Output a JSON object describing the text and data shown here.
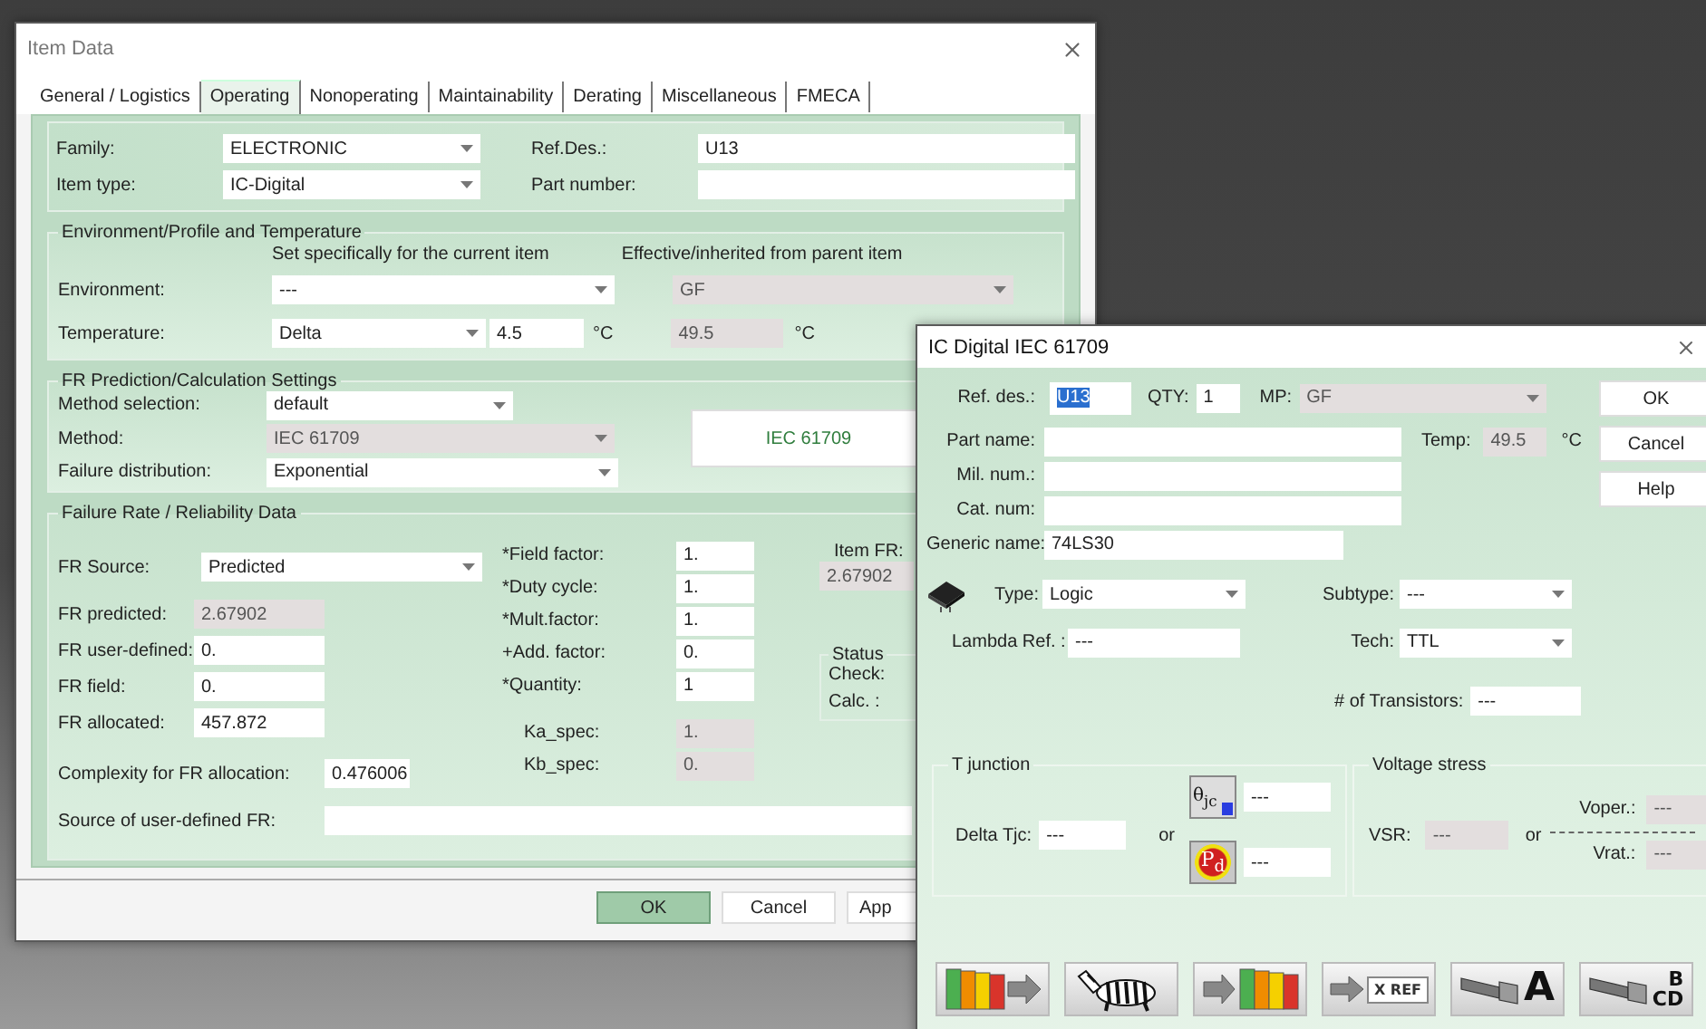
{
  "item_window": {
    "title": "Item Data",
    "tabs": [
      {
        "label": "General / Logistics",
        "selected": false
      },
      {
        "label": "Operating",
        "selected": true
      },
      {
        "label": "Nonoperating",
        "selected": false
      },
      {
        "label": "Maintainability",
        "selected": false
      },
      {
        "label": "Derating",
        "selected": false
      },
      {
        "label": "Miscellaneous",
        "selected": false
      },
      {
        "label": "FMECA",
        "selected": false
      }
    ],
    "family": {
      "label": "Family:",
      "value": "ELECTRONIC"
    },
    "item_type": {
      "label": "Item type:",
      "value": "IC-Digital"
    },
    "ref_des": {
      "label": "Ref.Des.:",
      "value": "U13"
    },
    "part_number": {
      "label": "Part number:"
    },
    "environment_group": {
      "title": "Environment/Profile and Temperature",
      "column_1": "Set specifically for the current item",
      "column_2": "Effective/inherited from parent item",
      "environment": {
        "label": "Environment:",
        "value": "---",
        "inherited": "GF"
      },
      "temperature": {
        "label": "Temperature:",
        "mode": "Delta",
        "value": "4.5",
        "unit": "°C",
        "inherited": "49.5",
        "inherited_unit": "°C"
      }
    },
    "prediction_group": {
      "title": "FR Prediction/Calculation Settings",
      "method_button": "IEC 61709",
      "fields": [
        {
          "label": "Method selection:",
          "value": "default",
          "disabled": false
        },
        {
          "label": "Method:",
          "value": "IEC 61709",
          "disabled": true
        },
        {
          "label": "Failure distribution:",
          "value": "Exponential",
          "disabled": false
        }
      ]
    },
    "failure_rate_group": {
      "title": "Failure Rate / Reliability Data",
      "fr_source": {
        "label": "FR Source:",
        "value": "Predicted"
      },
      "fr_fields": [
        {
          "label": "FR predicted:",
          "value": "2.67902",
          "disabled": true
        },
        {
          "label": "FR user-defined:",
          "value": "0.",
          "disabled": false
        },
        {
          "label": "FR field:",
          "value": "0.",
          "disabled": false
        },
        {
          "label": "FR allocated:",
          "value": "457.872",
          "disabled": false
        }
      ],
      "factors": [
        {
          "label": "*Field factor:",
          "value": "1.",
          "disabled": false
        },
        {
          "label": "*Duty cycle:",
          "value": "1.",
          "disabled": false
        },
        {
          "label": "*Mult.factor:",
          "value": "1.",
          "disabled": false
        },
        {
          "label": "+Add. factor:",
          "value": "0.",
          "disabled": false
        },
        {
          "label": "*Quantity:",
          "value": "1",
          "disabled": false
        },
        {
          "label": "Ka_spec:",
          "value": "1.",
          "disabled": true
        },
        {
          "label": "Kb_spec:",
          "value": "0.",
          "disabled": true
        }
      ],
      "item_fr": {
        "label": "Item FR:",
        "value": "2.67902"
      },
      "status": {
        "title": "Status",
        "check": "Check:",
        "calc": "Calc. :"
      },
      "complexity": {
        "label": "Complexity for FR allocation:",
        "value": "0.476006"
      },
      "source": {
        "label": "Source of user-defined FR:"
      }
    },
    "buttons": [
      {
        "label": "OK",
        "default": true
      },
      {
        "label": "Cancel",
        "default": false
      },
      {
        "label": "App",
        "default": false
      }
    ]
  },
  "ic_window": {
    "title": "IC Digital IEC 61709",
    "ref_des": {
      "label": "Ref. des.:",
      "value": "U13",
      "selected": true
    },
    "qty": {
      "label": "QTY:",
      "value": "1"
    },
    "mp": {
      "label": "MP:",
      "value": "GF"
    },
    "buttons": [
      "OK",
      "Cancel",
      "Help"
    ],
    "part_name": {
      "label": "Part name:"
    },
    "temp": {
      "label": "Temp:",
      "value": "49.5",
      "unit": "°C"
    },
    "mil_num": {
      "label": "Mil. num.:"
    },
    "cat_num": {
      "label": "Cat. num:"
    },
    "generic_name": {
      "label": "Generic name:",
      "value": "74LS30"
    },
    "type": {
      "label": "Type:",
      "value": "Logic"
    },
    "subtype": {
      "label": "Subtype:",
      "value": "---"
    },
    "lambda_ref": {
      "label": "Lambda Ref. :",
      "value": "---"
    },
    "tech": {
      "label": "Tech:",
      "value": "TTL"
    },
    "transistors": {
      "label": "# of Transistors:",
      "value": "---"
    },
    "t_junction": {
      "title": "T junction",
      "delta_tjc": {
        "label": "Delta Tjc:",
        "value": "---"
      },
      "or": "or",
      "theta_jc": {
        "icon_label": "θ$_{jc}$",
        "value": "---"
      },
      "power": {
        "icon_label": "P$_{d}$",
        "value": "---"
      }
    },
    "voltage_stress": {
      "title": "Voltage stress",
      "voper": {
        "label": "Voper.:",
        "value": "---"
      },
      "vsr": {
        "label": "VSR:",
        "value": "---"
      },
      "or": "or",
      "vrat": {
        "label": "Vrat.:",
        "value": "---"
      }
    },
    "toolbar": [
      {
        "kind": "books-out"
      },
      {
        "kind": "zebra"
      },
      {
        "kind": "books-in"
      },
      {
        "kind": "xref",
        "lines": [
          "X REF"
        ]
      },
      {
        "kind": "flashlight",
        "lines": [
          "A"
        ]
      },
      {
        "kind": "flashlight",
        "lines": [
          "B",
          "CD"
        ]
      }
    ]
  }
}
